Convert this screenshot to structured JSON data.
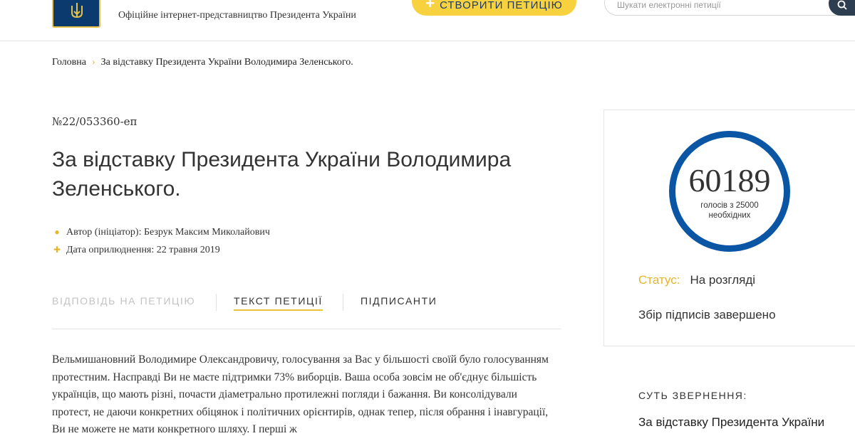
{
  "header": {
    "tagline": "Офіційне інтернет-представництво Президента України",
    "create_button": "СТВОРИТИ ПЕТИЦІЮ",
    "search_placeholder": "Шукати електронні петиції"
  },
  "breadcrumb": {
    "home": "Головна",
    "current": "За відставку Президента України Володимира Зеленського."
  },
  "petition": {
    "number": "№22/053360-еп",
    "title": "За відставку Президента України Володимира Зеленського.",
    "author": "Автор (ініціатор): Безрук Максим Миколайович",
    "published": "Дата оприлюднення: 22 травня 2019",
    "body": "Вельмишановний Володимире Олександровичу, голосування за Вас у більшості своїй було голосуванням протестним. Насправді Ви не маєте підтримки 73% виборців. Ваша особа зовсім не об'єднує більшість українців, що мають різні, почасти діаметрально протилежні погляди і бажання. Ви консолідували протест, не даючи конкретних обіцянок і політичних орієнтирів, однак тепер, після обрання і інавгурації, Ви не можете не мати конкретного шляху. І перші ж"
  },
  "tabs": {
    "answer": "ВІДПОВІДЬ НА ПЕТИЦІЮ",
    "text": "ТЕКСТ ПЕТИЦІЇ",
    "signers": "ПІДПИСАНТИ"
  },
  "sidebar": {
    "votes": "60189",
    "votes_label": "голосів з 25000 необхідних",
    "status_label": "Статус:",
    "status_value": "На розгляді",
    "collection": "Збір підписів завершено",
    "essence_heading": "СУТЬ ЗВЕРНЕННЯ:",
    "essence_text": "За відставку Президента України"
  },
  "colors": {
    "accent_yellow": "#f7d23e",
    "circle_blue": "#0b56a4",
    "logo_blue": "#0b3b6e"
  }
}
